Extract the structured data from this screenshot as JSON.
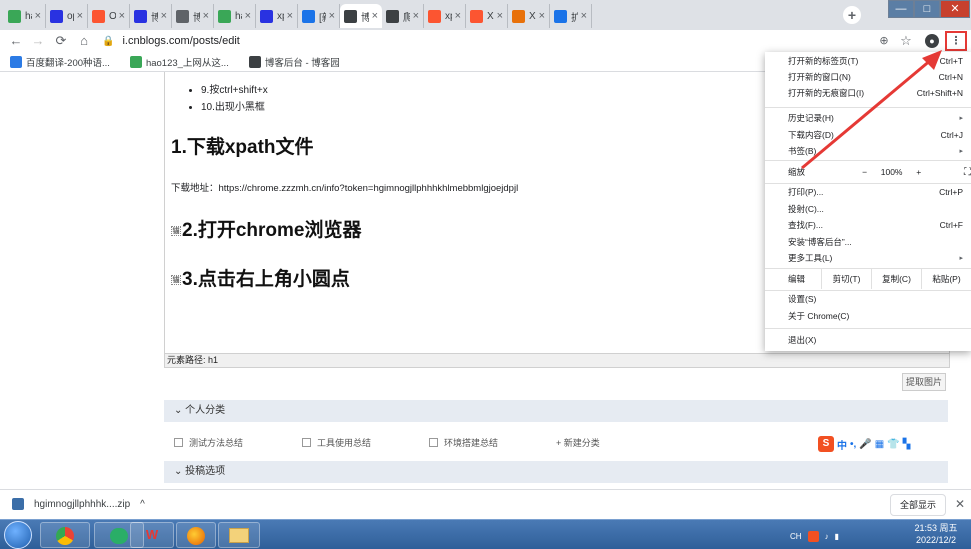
{
  "tabs": [
    {
      "title": "hac",
      "icon": "hao123-icon",
      "color": "#3aa757"
    },
    {
      "title": "ope",
      "icon": "baidu-paw-icon",
      "color": "#2932e1"
    },
    {
      "title": "OP",
      "icon": "csdn-c-icon",
      "color": "#fc5531"
    },
    {
      "title": "博客",
      "icon": "baidu-paw-icon",
      "color": "#2932e1"
    },
    {
      "title": "博客",
      "icon": "pen-icon",
      "color": "#5f6368"
    },
    {
      "title": "hac",
      "icon": "hao123-icon",
      "color": "#3aa757"
    },
    {
      "title": "xpa",
      "icon": "baidu-paw-icon",
      "color": "#2932e1"
    },
    {
      "title": "[新",
      "icon": "loading-icon",
      "color": "#1a73e8"
    },
    {
      "title": "博客",
      "icon": "cnblogs-icon",
      "color": "#3c4043"
    },
    {
      "title": "爬虫",
      "icon": "cnblogs-icon",
      "color": "#3c4043"
    },
    {
      "title": "xpa",
      "icon": "csdn-c-icon",
      "color": "#fc5531"
    },
    {
      "title": "Xpa",
      "icon": "csdn-c-icon",
      "color": "#fc5531"
    },
    {
      "title": "XPa",
      "icon": "rainbow-icon",
      "color": "#e8710a"
    },
    {
      "title": "扩展",
      "icon": "puzzle-icon",
      "color": "#1a73e8"
    }
  ],
  "window_buttons": {
    "minimize": "—",
    "maximize": "□",
    "close": "✕"
  },
  "url": "i.cnblogs.com/posts/edit",
  "bookmarks": [
    {
      "label": "百度翻译-200种语...",
      "color": "#2c7be5"
    },
    {
      "label": "hao123_上网从这...",
      "color": "#3aa757"
    },
    {
      "label": "博客后台 - 博客园",
      "color": "#3c4043"
    }
  ],
  "editor": {
    "list_items": [
      "9.按ctrl+shift+x",
      "10.出现小黑框"
    ],
    "heading1": "1.下载xpath文件",
    "download_text": "下载地址：https://chrome.zzzmh.cn/info?token=hgimnogjllphhhkhlmebbmlgjoejdpjl",
    "heading2": "2.打开chrome浏览器",
    "heading3": "3.点击右上角小圆点",
    "anchor_mark": "锚"
  },
  "element_path": "元素路径: h1",
  "extract_image_button": "提取图片",
  "personal_category": "个人分类",
  "categories": [
    "测试方法总结",
    "工具使用总结",
    "环境搭建总结"
  ],
  "new_category": "+ 新建分类",
  "post_options": "投稿选项",
  "ime_items": [
    "S",
    "中",
    "•,",
    "🎤",
    "▦",
    "👕",
    "▚"
  ],
  "chrome_menu": {
    "group1": [
      {
        "label": "打开新的标签页(T)",
        "shortcut": "Ctrl+T"
      },
      {
        "label": "打开新的窗口(N)",
        "shortcut": "Ctrl+N"
      },
      {
        "label": "打开新的无痕窗口(I)",
        "shortcut": "Ctrl+Shift+N"
      }
    ],
    "group2": [
      {
        "label": "历史记录(H)",
        "shortcut": "▸"
      },
      {
        "label": "下载内容(D)",
        "shortcut": "Ctrl+J"
      },
      {
        "label": "书签(B)",
        "shortcut": "▸"
      }
    ],
    "zoom": {
      "label": "缩放",
      "minus": "−",
      "value": "100%",
      "plus": "+",
      "fullscreen": "⛶"
    },
    "group3": [
      {
        "label": "打印(P)...",
        "shortcut": "Ctrl+P"
      },
      {
        "label": "投射(C)...",
        "shortcut": ""
      },
      {
        "label": "查找(F)...",
        "shortcut": "Ctrl+F"
      },
      {
        "label": "安装“博客后台”...",
        "shortcut": ""
      },
      {
        "label": "更多工具(L)",
        "shortcut": "▸"
      }
    ],
    "edit": {
      "label": "编辑",
      "cut": "剪切(T)",
      "copy": "复制(C)",
      "paste": "粘贴(P)"
    },
    "group4": [
      {
        "label": "设置(S)",
        "shortcut": ""
      },
      {
        "label": "关于 Chrome(C)",
        "shortcut": ""
      }
    ],
    "exit": "退出(X)"
  },
  "download": {
    "filename": "hgimnogjllphhhk....zip",
    "chevron": "^",
    "show_all": "全部显示",
    "close": "✕"
  },
  "taskbar": {
    "apps": [
      "chrome",
      "wechat",
      "wps",
      "firefox",
      "folder"
    ],
    "tray_lang": "CH",
    "time": "21:53 周五",
    "date": "2022/12/2"
  },
  "colors": {
    "annotation_red": "#e53935",
    "section_bg": "#e6ebf2",
    "taskbar": "#2f5f99"
  }
}
